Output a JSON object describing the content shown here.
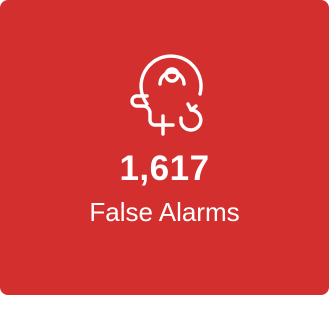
{
  "card": {
    "count": "1,617",
    "label": "False Alarms",
    "icon": "alarm-bell-icon",
    "background_color": "#D32F2F",
    "text_color": "#FFFFFF"
  }
}
